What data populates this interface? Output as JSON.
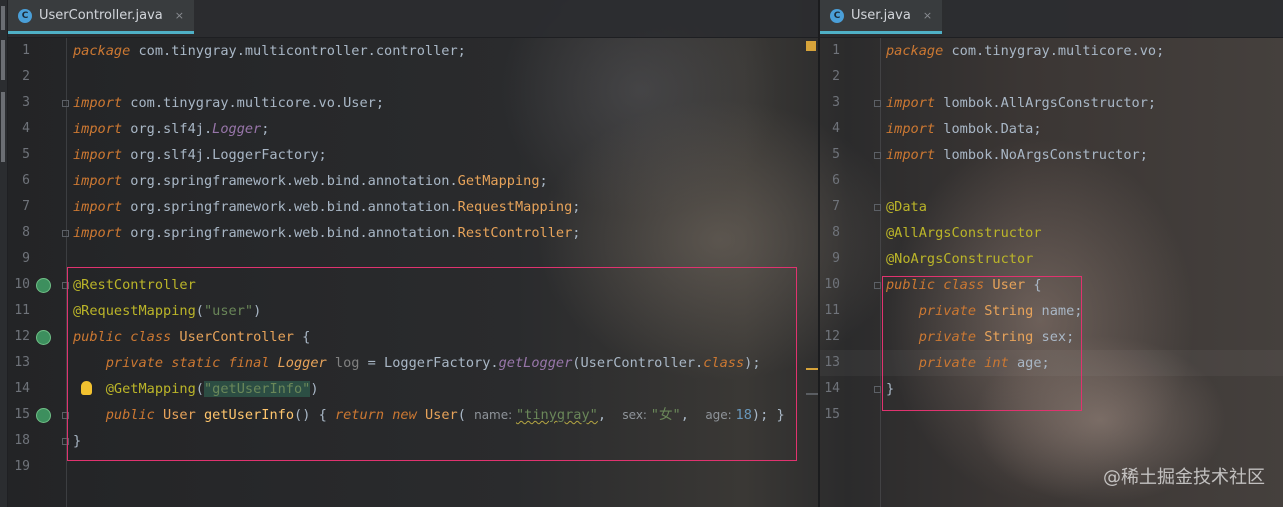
{
  "left_tab": {
    "label": "UserController.java",
    "icon": "java-class-icon",
    "close": "×"
  },
  "right_tab": {
    "label": "User.java",
    "icon": "java-class-icon",
    "close": "×"
  },
  "left_code": [
    {
      "n": "1",
      "parts": [
        [
          "kw",
          "package"
        ],
        [
          "pl",
          " com.tinygray.multicontroller.controller;"
        ]
      ]
    },
    {
      "n": "2",
      "parts": []
    },
    {
      "n": "3",
      "parts": [
        [
          "kw",
          "import"
        ],
        [
          "pl",
          " com.tinygray.multicore.vo.User;"
        ]
      ]
    },
    {
      "n": "4",
      "parts": [
        [
          "kw",
          "import"
        ],
        [
          "pl",
          " org.slf4j."
        ],
        [
          "itl",
          "Logger"
        ],
        [
          "pl",
          ";"
        ]
      ]
    },
    {
      "n": "5",
      "parts": [
        [
          "kw",
          "import"
        ],
        [
          "pl",
          " org.slf4j.LoggerFactory;"
        ]
      ]
    },
    {
      "n": "6",
      "parts": [
        [
          "kw",
          "import"
        ],
        [
          "pl",
          " org.springframework.web.bind.annotation."
        ],
        [
          "ty",
          "GetMapping"
        ],
        [
          "pl",
          ";"
        ]
      ]
    },
    {
      "n": "7",
      "parts": [
        [
          "kw",
          "import"
        ],
        [
          "pl",
          " org.springframework.web.bind.annotation."
        ],
        [
          "ty",
          "RequestMapping"
        ],
        [
          "pl",
          ";"
        ]
      ]
    },
    {
      "n": "8",
      "parts": [
        [
          "kw",
          "import"
        ],
        [
          "pl",
          " org.springframework.web.bind.annotation."
        ],
        [
          "ty",
          "RestController"
        ],
        [
          "pl",
          ";"
        ]
      ]
    },
    {
      "n": "9",
      "parts": []
    },
    {
      "n": "10",
      "parts": [
        [
          "an",
          "@RestController"
        ]
      ]
    },
    {
      "n": "11",
      "parts": [
        [
          "an",
          "@RequestMapping"
        ],
        [
          "pl",
          "("
        ],
        [
          "st",
          "\"user\""
        ],
        [
          "pl",
          ")"
        ]
      ]
    },
    {
      "n": "12",
      "parts": [
        [
          "kw",
          "public class "
        ],
        [
          "ty",
          "UserController"
        ],
        [
          "pl",
          " {"
        ]
      ]
    },
    {
      "n": "13",
      "parts": [
        [
          "pl",
          "    "
        ],
        [
          "kw",
          "private static final "
        ],
        [
          "tyi",
          "Logger "
        ],
        [
          "cm",
          "log"
        ],
        [
          "pl",
          " = LoggerFactory."
        ],
        [
          "fni",
          "getLogger"
        ],
        [
          "pl",
          "(UserController."
        ],
        [
          "kw",
          "class"
        ],
        [
          "pl",
          ");"
        ]
      ]
    },
    {
      "n": "14",
      "parts": [
        [
          "pl",
          "    "
        ],
        [
          "an",
          "@GetMapping"
        ],
        [
          "pl",
          "("
        ],
        [
          "sts",
          "\"getUserInfo\""
        ],
        [
          "pl",
          ")"
        ]
      ]
    },
    {
      "n": "15",
      "parts": [
        [
          "pl",
          "    "
        ],
        [
          "kw",
          "public "
        ],
        [
          "ty",
          "User"
        ],
        [
          "pl",
          " "
        ],
        [
          "fn",
          "getUserInfo"
        ],
        [
          "pl",
          "() { "
        ],
        [
          "kw",
          "return new "
        ],
        [
          "ty",
          "User"
        ],
        [
          "pl",
          "( "
        ],
        [
          "hint",
          "name: "
        ],
        [
          "stw",
          "\"tinygray\""
        ],
        [
          "pl",
          ",  "
        ],
        [
          "hint",
          "sex: "
        ],
        [
          "st",
          "\"女\""
        ],
        [
          "pl",
          ",  "
        ],
        [
          "hint",
          "age: "
        ],
        [
          "nu",
          "18"
        ],
        [
          "pl",
          "); }"
        ]
      ]
    },
    {
      "n": "18",
      "parts": [
        [
          "pl",
          "}"
        ]
      ]
    },
    {
      "n": "19",
      "parts": []
    }
  ],
  "right_code": [
    {
      "n": "1",
      "parts": [
        [
          "kw",
          "package"
        ],
        [
          "pl",
          " com.tinygray.multicore.vo;"
        ]
      ]
    },
    {
      "n": "2",
      "parts": []
    },
    {
      "n": "3",
      "parts": [
        [
          "kw",
          "import"
        ],
        [
          "pl",
          " lombok.AllArgsConstructor;"
        ]
      ]
    },
    {
      "n": "4",
      "parts": [
        [
          "kw",
          "import"
        ],
        [
          "pl",
          " lombok.Data;"
        ]
      ]
    },
    {
      "n": "5",
      "parts": [
        [
          "kw",
          "import"
        ],
        [
          "pl",
          " lombok.NoArgsConstructor;"
        ]
      ]
    },
    {
      "n": "6",
      "parts": []
    },
    {
      "n": "7",
      "parts": [
        [
          "an",
          "@Data"
        ]
      ]
    },
    {
      "n": "8",
      "parts": [
        [
          "an",
          "@AllArgsConstructor"
        ]
      ]
    },
    {
      "n": "9",
      "parts": [
        [
          "an",
          "@NoArgsConstructor"
        ]
      ]
    },
    {
      "n": "10",
      "parts": [
        [
          "kw",
          "public class "
        ],
        [
          "ty",
          "User"
        ],
        [
          "pl",
          " {"
        ]
      ]
    },
    {
      "n": "11",
      "parts": [
        [
          "pl",
          "    "
        ],
        [
          "kw",
          "private "
        ],
        [
          "ty",
          "String"
        ],
        [
          "pl",
          " name;"
        ]
      ]
    },
    {
      "n": "12",
      "parts": [
        [
          "pl",
          "    "
        ],
        [
          "kw",
          "private "
        ],
        [
          "ty",
          "String"
        ],
        [
          "pl",
          " sex;"
        ]
      ]
    },
    {
      "n": "13",
      "parts": [
        [
          "pl",
          "    "
        ],
        [
          "kw",
          "private int"
        ],
        [
          "pl",
          " age;"
        ]
      ]
    },
    {
      "n": "14",
      "parts": [
        [
          "pl",
          "}"
        ]
      ]
    },
    {
      "n": "15",
      "parts": []
    }
  ],
  "watermark": "@稀土掘金技术社区",
  "colors": {
    "highlight_box": "#e0336f",
    "tab_underline": "#4fb0c6",
    "warning_marker": "#d6a33a"
  }
}
